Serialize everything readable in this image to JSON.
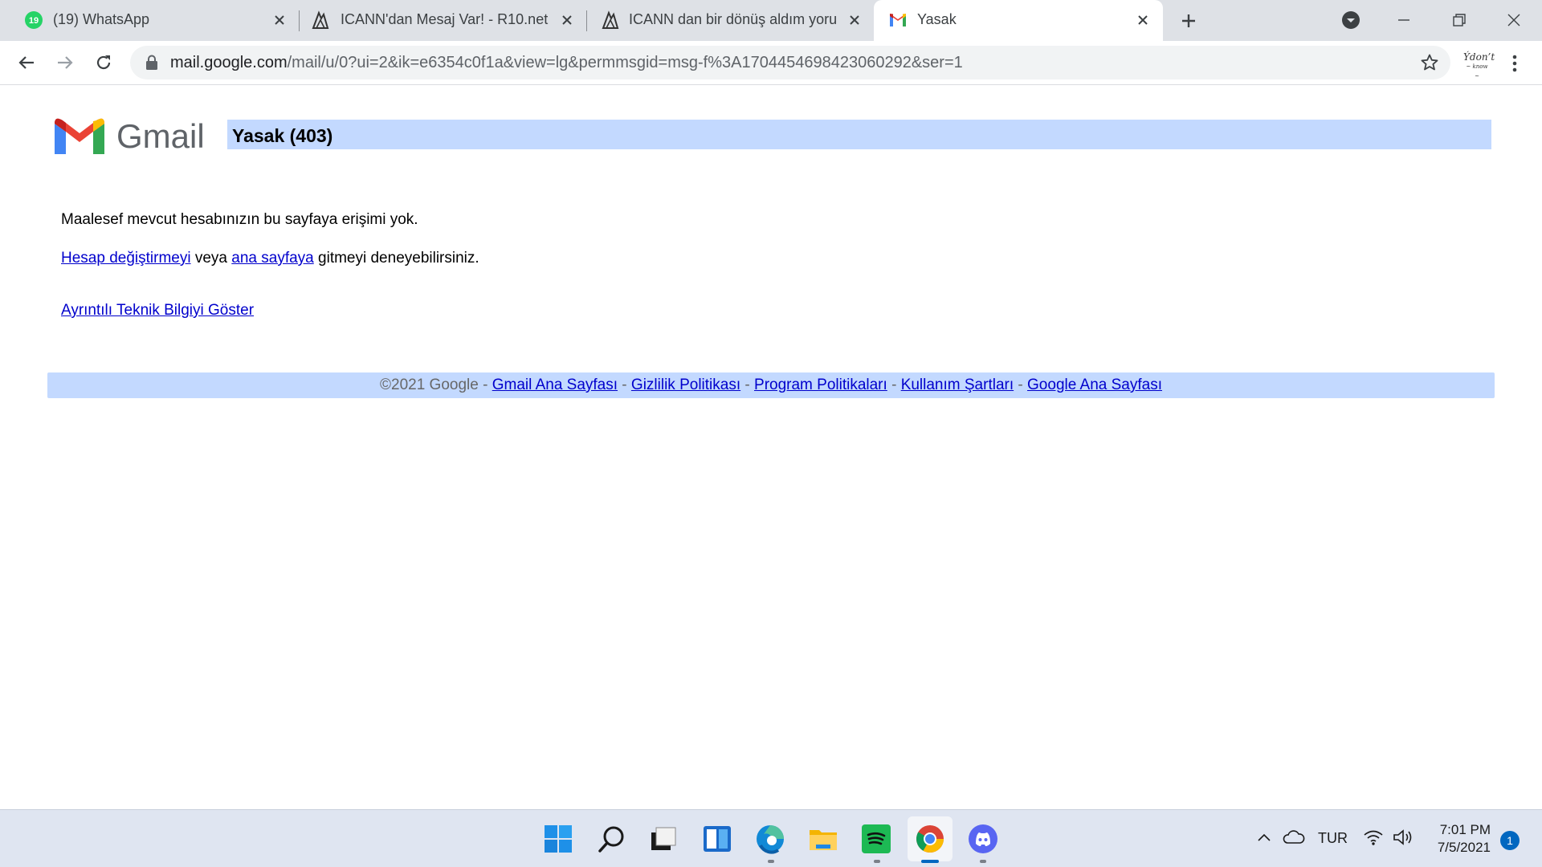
{
  "tabs": [
    {
      "title": "(19) WhatsApp",
      "badge": "19",
      "favicon": "whatsapp-icon",
      "active": false
    },
    {
      "title": "ICANN'dan Mesaj Var! - R10.net",
      "favicon": "r10-icon",
      "active": false
    },
    {
      "title": "ICANN dan bir dönüş aldım yoru",
      "favicon": "r10-icon",
      "active": false
    },
    {
      "title": "Yasak",
      "favicon": "gmail-icon",
      "active": true
    }
  ],
  "address_bar": {
    "host": "mail.google.com",
    "path": "/mail/u/0?ui=2&ik=e6354c0f1a&view=lg&permmsgid=msg-f%3A1704454698423060292&ser=1"
  },
  "profile": {
    "line1": "Ýdon’t",
    "line2": "~ know ~"
  },
  "page": {
    "logo_text": "Gmail",
    "title": "Yasak (403)",
    "message": "Maalesef mevcut hesabınızın bu sayfaya erişimi yok.",
    "suggestion": {
      "link1": "Hesap değiştirmeyi",
      "mid": " veya ",
      "link2": "ana sayfaya",
      "tail": " gitmeyi deneyebilirsiniz."
    },
    "details_link": "Ayrıntılı Teknik Bilgiyi Göster",
    "footer": {
      "copyright": "©2021 Google",
      "sep": " - ",
      "links": [
        "Gmail Ana Sayfası",
        "Gizlilik Politikası",
        "Program Politikaları",
        "Kullanım Şartları",
        "Google Ana Sayfası"
      ]
    }
  },
  "taskbar": {
    "apps": [
      "start-icon",
      "search-icon",
      "task-view-icon",
      "widgets-icon",
      "edge-icon",
      "file-explorer-icon",
      "spotify-icon",
      "chrome-icon",
      "discord-icon"
    ],
    "language": "TUR",
    "time": "7:01 PM",
    "date": "7/5/2021",
    "notifications": "1"
  },
  "colors": {
    "tabstrip_bg": "#dee1e6",
    "title_bar_bg": "#c3d9ff",
    "link": "#0000cc",
    "taskbar_bg": "#dfe5f1"
  }
}
